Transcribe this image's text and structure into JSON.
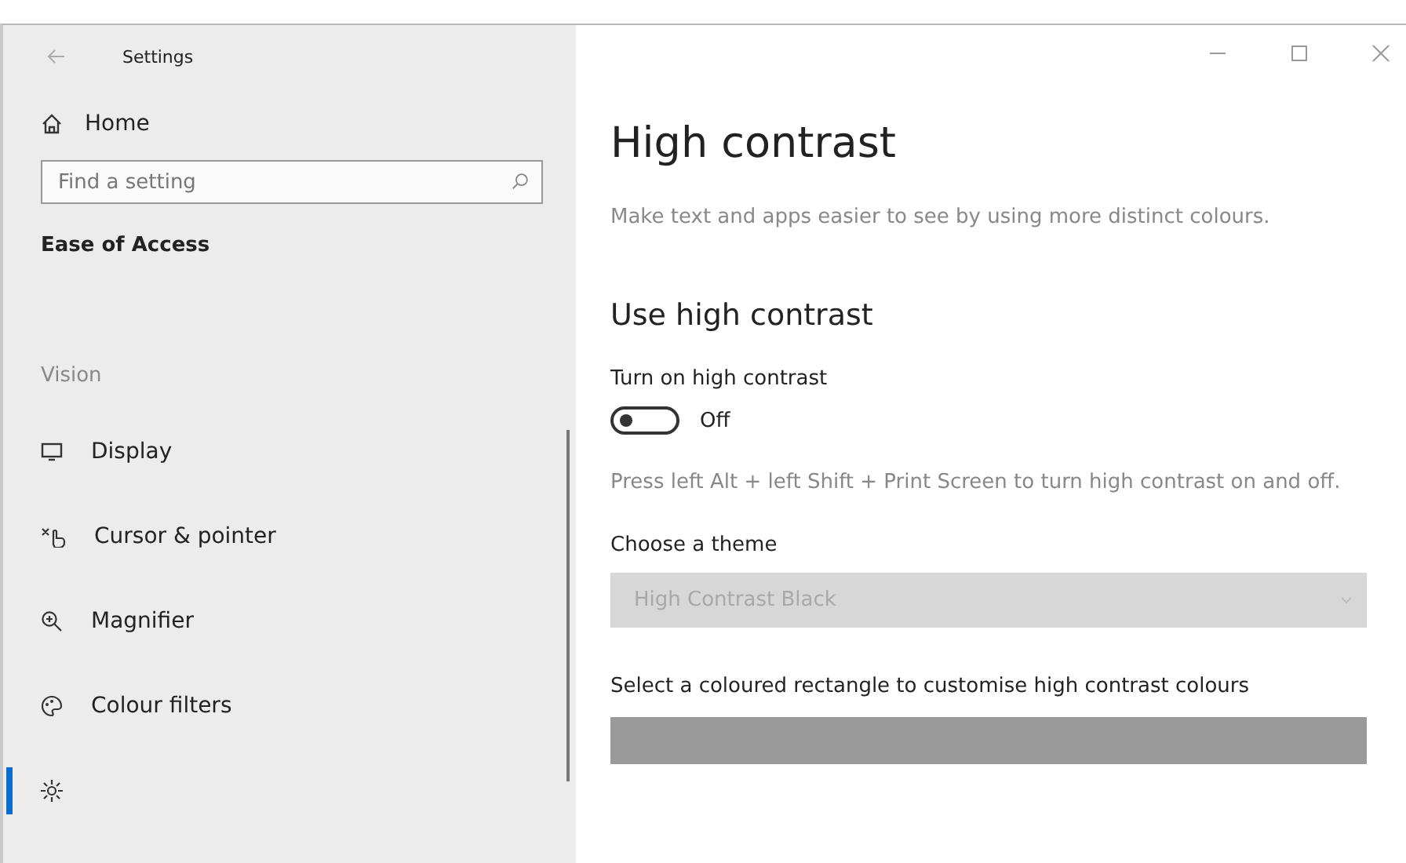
{
  "window": {
    "title": "Settings"
  },
  "sidebar": {
    "home": "Home",
    "search": {
      "placeholder": "Find a setting"
    },
    "section": "Ease of Access",
    "group": "Vision",
    "items": [
      {
        "label": "Display",
        "selected": false
      },
      {
        "label": "Cursor & pointer",
        "selected": false
      },
      {
        "label": "Magnifier",
        "selected": false
      },
      {
        "label": "Colour filters",
        "selected": false
      },
      {
        "selected": true
      }
    ]
  },
  "content": {
    "title": "High contrast",
    "description": "Make text and apps easier to see by using more distinct colours.",
    "section": "Use high contrast",
    "toggle": {
      "label": "Turn on high contrast",
      "on": false,
      "state_text": "Off"
    },
    "hint": "Press left Alt + left Shift + Print Screen to turn high contrast on and off.",
    "theme": {
      "label": "Choose a theme",
      "value": "High Contrast Black",
      "disabled": true
    },
    "colours_label": "Select a coloured rectangle to customise high contrast colours"
  }
}
